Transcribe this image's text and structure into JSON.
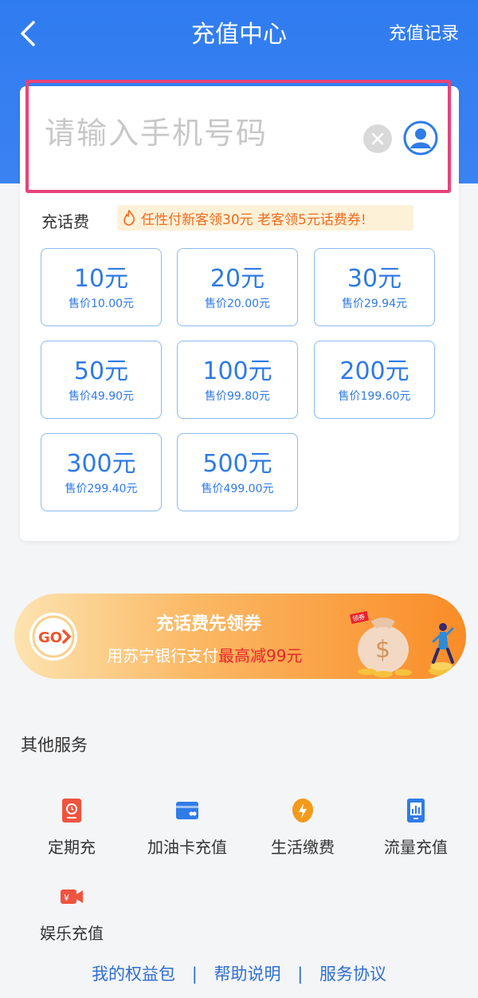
{
  "header": {
    "title": "充值中心",
    "record_label": "充值记录"
  },
  "phone": {
    "placeholder": "请输入手机号码",
    "value": ""
  },
  "recharge": {
    "section_label": "充话费",
    "promo_text": "任性付新客领30元 老客领5元话费券!",
    "denominations": [
      {
        "amount": "10元",
        "price": "售价10.00元"
      },
      {
        "amount": "20元",
        "price": "售价20.00元"
      },
      {
        "amount": "30元",
        "price": "售价29.94元"
      },
      {
        "amount": "50元",
        "price": "售价49.90元"
      },
      {
        "amount": "100元",
        "price": "售价99.80元"
      },
      {
        "amount": "200元",
        "price": "售价199.60元"
      },
      {
        "amount": "300元",
        "price": "售价299.40元"
      },
      {
        "amount": "500元",
        "price": "售价499.00元"
      }
    ]
  },
  "banner": {
    "go_label": "GO",
    "title": "充话费先领券",
    "subtitle_prefix": "用苏宁银行支付",
    "subtitle_highlight": "最高减99元",
    "tag": "领券"
  },
  "services": {
    "title": "其他服务",
    "items": [
      {
        "label": "定期充",
        "icon": "calendar-phone-icon"
      },
      {
        "label": "加油卡充值",
        "icon": "fuel-card-icon"
      },
      {
        "label": "生活缴费",
        "icon": "lightning-icon"
      },
      {
        "label": "流量充值",
        "icon": "data-flow-icon"
      },
      {
        "label": "娱乐充值",
        "icon": "video-camera-icon"
      }
    ]
  },
  "footer": {
    "links": [
      "我的权益包",
      "帮助说明",
      "服务协议"
    ],
    "separator": "|"
  },
  "colors": {
    "primary": "#2f7ce8",
    "highlight_border": "#e8437a",
    "promo_orange": "#f06a1e"
  }
}
